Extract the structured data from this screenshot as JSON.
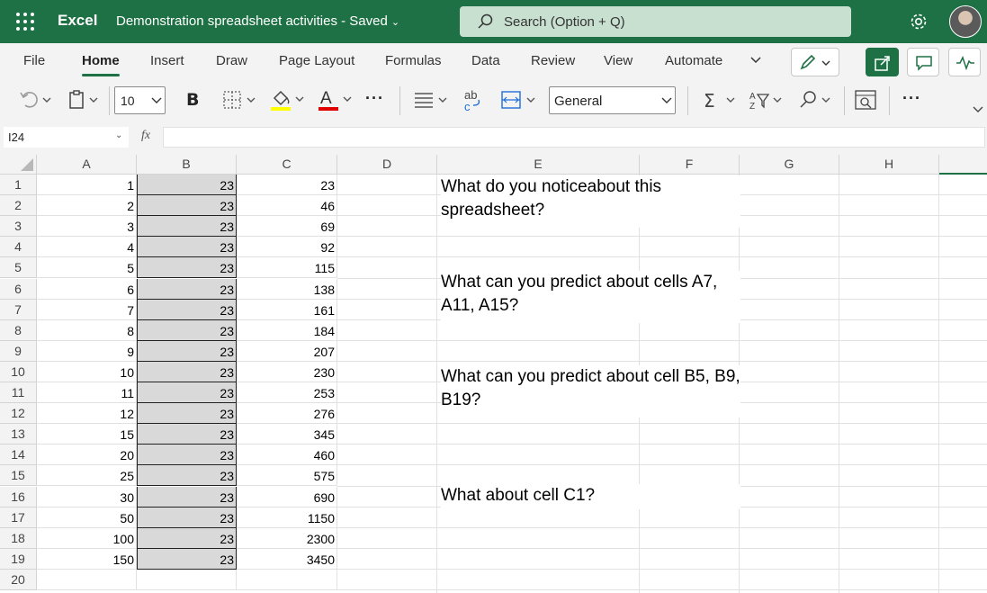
{
  "titlebar": {
    "app_name": "Excel",
    "doc_title": "Demonstration spreadsheet activities  -  Saved",
    "search_placeholder": "Search (Option + Q)"
  },
  "tabs": [
    "File",
    "Home",
    "Insert",
    "Draw",
    "Page Layout",
    "Formulas",
    "Data",
    "Review",
    "View",
    "Automate"
  ],
  "active_tab": "Home",
  "toolbar": {
    "font_size": "10",
    "bold": "B",
    "number_format": "General",
    "ellipsis": "···"
  },
  "formula_bar": {
    "name_box": "I24",
    "fx": "fx",
    "formula": ""
  },
  "columns": [
    "A",
    "B",
    "C",
    "D",
    "E",
    "F",
    "G",
    "H"
  ],
  "rows": [
    {
      "n": "1",
      "a": "1",
      "b": "23",
      "c": "23"
    },
    {
      "n": "2",
      "a": "2",
      "b": "23",
      "c": "46"
    },
    {
      "n": "3",
      "a": "3",
      "b": "23",
      "c": "69"
    },
    {
      "n": "4",
      "a": "4",
      "b": "23",
      "c": "92"
    },
    {
      "n": "5",
      "a": "5",
      "b": "23",
      "c": "115"
    },
    {
      "n": "6",
      "a": "6",
      "b": "23",
      "c": "138"
    },
    {
      "n": "7",
      "a": "7",
      "b": "23",
      "c": "161"
    },
    {
      "n": "8",
      "a": "8",
      "b": "23",
      "c": "184"
    },
    {
      "n": "9",
      "a": "9",
      "b": "23",
      "c": "207"
    },
    {
      "n": "10",
      "a": "10",
      "b": "23",
      "c": "230"
    },
    {
      "n": "11",
      "a": "11",
      "b": "23",
      "c": "253"
    },
    {
      "n": "12",
      "a": "12",
      "b": "23",
      "c": "276"
    },
    {
      "n": "13",
      "a": "15",
      "b": "23",
      "c": "345"
    },
    {
      "n": "14",
      "a": "20",
      "b": "23",
      "c": "460"
    },
    {
      "n": "15",
      "a": "25",
      "b": "23",
      "c": "575"
    },
    {
      "n": "16",
      "a": "30",
      "b": "23",
      "c": "690"
    },
    {
      "n": "17",
      "a": "50",
      "b": "23",
      "c": "1150"
    },
    {
      "n": "18",
      "a": "100",
      "b": "23",
      "c": "2300"
    },
    {
      "n": "19",
      "a": "150",
      "b": "23",
      "c": "3450"
    },
    {
      "n": "20",
      "a": "",
      "b": "",
      "c": ""
    }
  ],
  "questions": [
    "What do you noticeabout this spreadsheet?",
    "What can you predict about cells A7, A11, A15?",
    "What can you predict about cell B5, B9, B19?",
    "What about cell C1?"
  ],
  "colors": {
    "brand": "#1e7145",
    "shaded_cell": "#d9d9d9",
    "fill_underline": "#ffff00",
    "font_color_underline": "#e00000"
  }
}
